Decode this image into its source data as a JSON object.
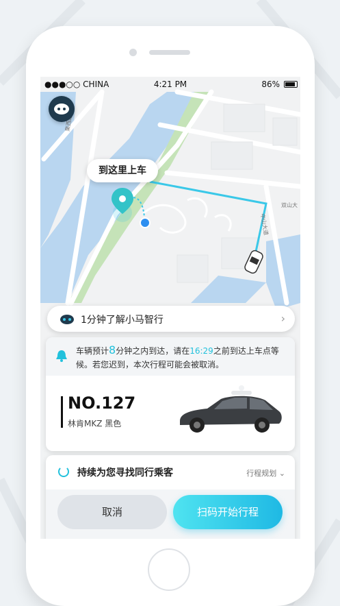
{
  "status_bar": {
    "carrier": "●●●○○ CHINA",
    "time": "4:21 PM",
    "battery": "86%"
  },
  "map": {
    "pickup_label": "到这里上车",
    "road_labels": [
      "栗西路",
      "双山大",
      "中山大道"
    ]
  },
  "promo_bar": {
    "text": "1分钟了解小马智行"
  },
  "notice": {
    "part1": "车辆预计",
    "minutes": "8",
    "part2": "分钟之内到达，请在",
    "deadline": "16:29",
    "part3": "之前到达上车点等候。若您迟到，本次行程可能会被取消。"
  },
  "vehicle": {
    "plate": "NO.127",
    "model": "林肯MKZ 黑色"
  },
  "trip_status": {
    "label": "持续为您寻找同行乘客",
    "route_plan": "行程规划"
  },
  "actions": {
    "cancel": "取消",
    "scan_start": "扫码开始行程"
  },
  "colors": {
    "accent": "#22c1dc",
    "route": "#3ac8e8",
    "river": "#b9d6f0",
    "park": "#c5e3b8"
  }
}
